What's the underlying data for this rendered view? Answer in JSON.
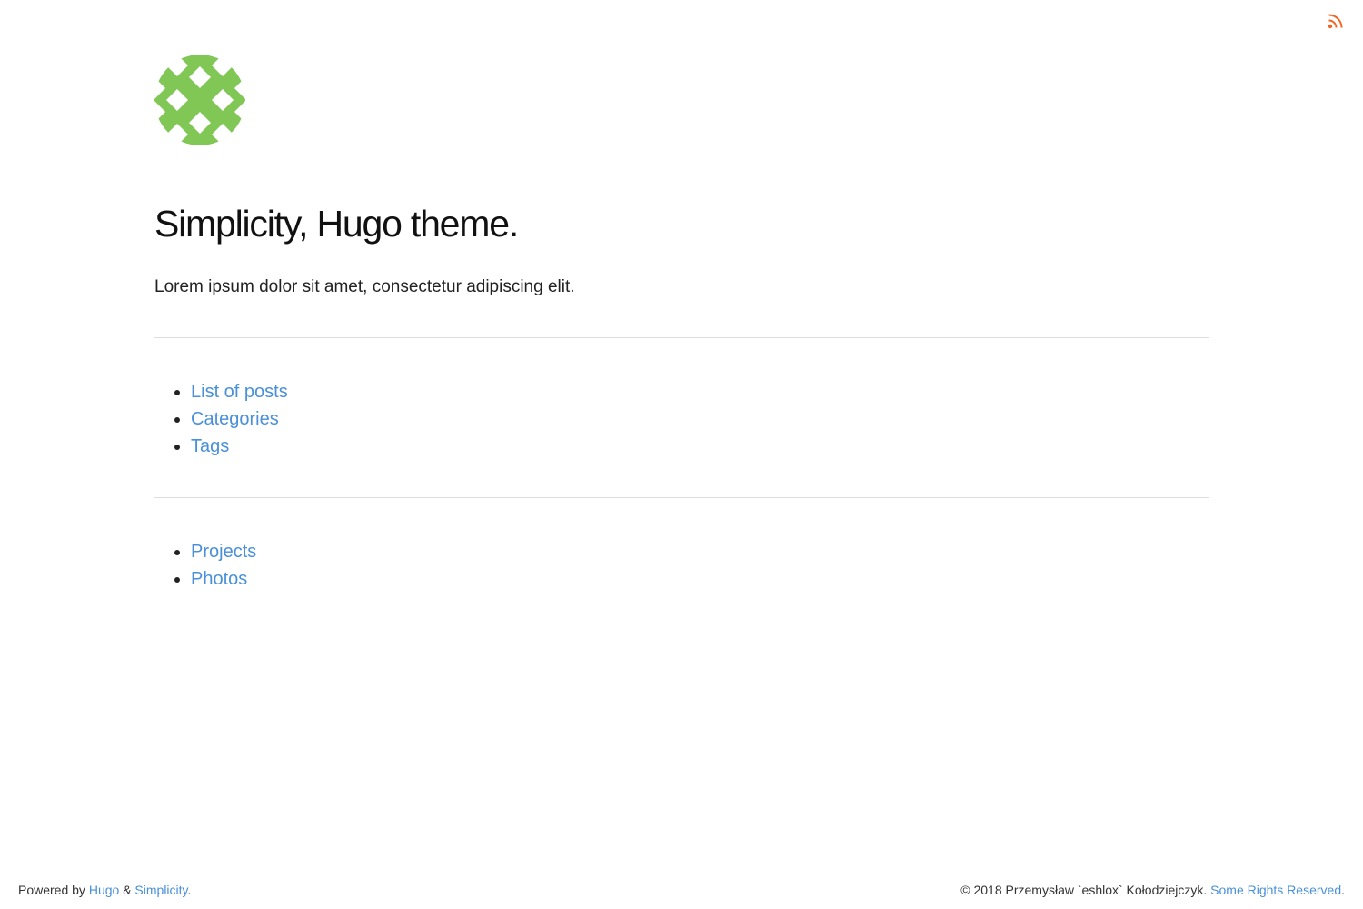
{
  "header": {
    "rss_icon": "rss-feed-icon",
    "rss_color": "#f26522",
    "logo_icon": "green-geometric-pattern-logo",
    "logo_color": "#80c756"
  },
  "main": {
    "title": "Simplicity, Hugo theme.",
    "description": "Lorem ipsum dolor sit amet, consectetur adipiscing elit.",
    "nav_primary": [
      "List of posts",
      "Categories",
      "Tags"
    ],
    "nav_secondary": [
      "Projects",
      "Photos"
    ]
  },
  "footer": {
    "powered_by": "Powered by",
    "hugo": "Hugo",
    "amp": "&",
    "simplicity": "Simplicity",
    "period": ".",
    "copyright": "© 2018 Przemysław `eshlox` Kołodziejczyk.",
    "rights": "Some Rights Reserved",
    "period2": "."
  },
  "colors": {
    "link": "#4a90d9",
    "text": "#222222",
    "divider": "#dedede"
  }
}
